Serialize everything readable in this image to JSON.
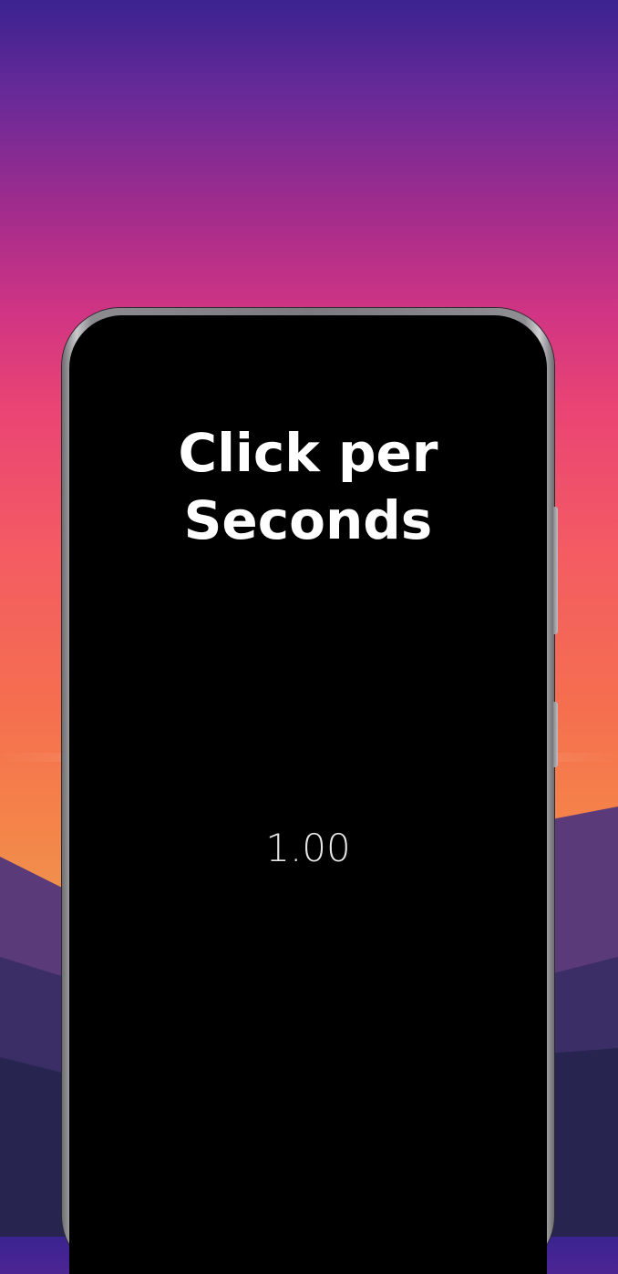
{
  "app": {
    "title": "Click per Seconds",
    "cps_value": "1.00"
  },
  "colors": {
    "screen_background": "#000000",
    "title_text": "#ffffff",
    "value_text": "#e6e6e6"
  }
}
